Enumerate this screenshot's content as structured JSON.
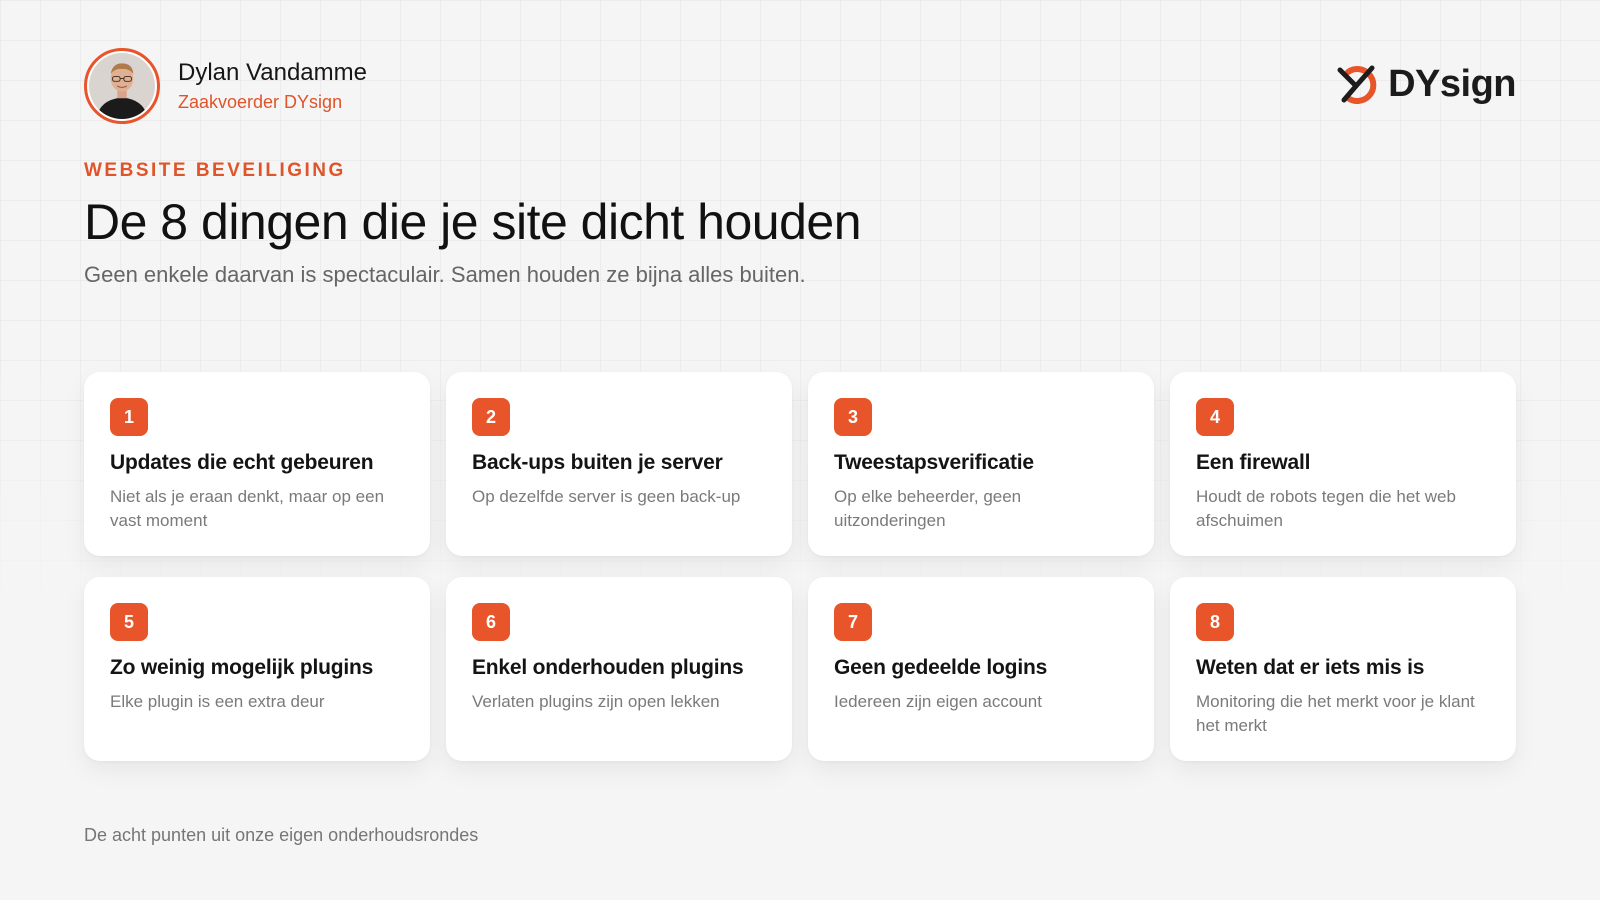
{
  "author": {
    "name": "Dylan Vandamme",
    "role": "Zaakvoerder DYsign"
  },
  "brand": {
    "name": "DYsign",
    "accent": "#e8552a"
  },
  "eyebrow": "WEBSITE BEVEILIGING",
  "title": "De 8 dingen die je site dicht houden",
  "subtitle": "Geen enkele daarvan is spectaculair. Samen houden ze bijna alles buiten.",
  "cards": [
    {
      "number": "1",
      "title": "Updates die echt gebeuren",
      "description": "Niet als je eraan denkt, maar op een vast moment"
    },
    {
      "number": "2",
      "title": "Back-ups buiten je server",
      "description": "Op dezelfde server is geen back-up"
    },
    {
      "number": "3",
      "title": "Tweestapsverificatie",
      "description": "Op elke beheerder, geen uitzonderingen"
    },
    {
      "number": "4",
      "title": "Een firewall",
      "description": "Houdt de robots tegen die het web afschuimen"
    },
    {
      "number": "5",
      "title": "Zo weinig mogelijk plugins",
      "description": "Elke plugin is een extra deur"
    },
    {
      "number": "6",
      "title": "Enkel onderhouden plugins",
      "description": "Verlaten plugins zijn open lekken"
    },
    {
      "number": "7",
      "title": "Geen gedeelde logins",
      "description": "Iedereen zijn eigen account"
    },
    {
      "number": "8",
      "title": "Weten dat er iets mis is",
      "description": "Monitoring die het merkt voor je klant het merkt"
    }
  ],
  "footer": "De acht punten uit onze eigen onderhoudsrondes"
}
